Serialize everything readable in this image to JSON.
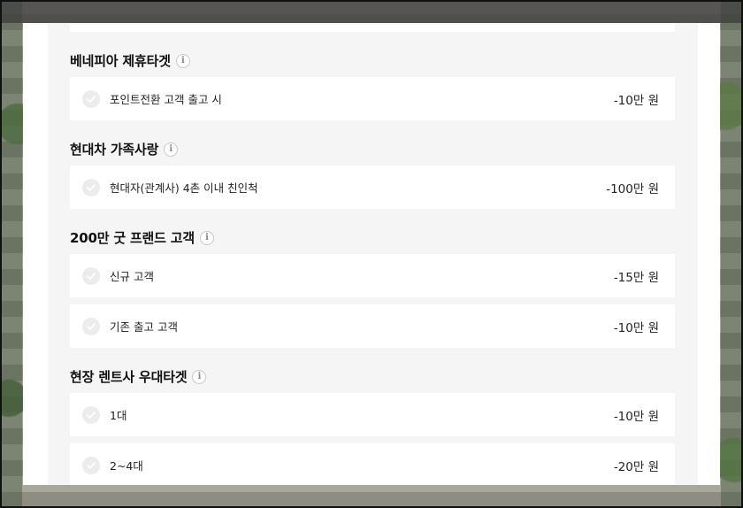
{
  "sections": [
    {
      "title": "베네피아 제휴타겟",
      "items": [
        {
          "label": "포인트전환 고객 출고 시",
          "amount": "-10만 원"
        }
      ]
    },
    {
      "title": "현대차 가족사랑",
      "items": [
        {
          "label": "현대자(관계사) 4촌 이내 친인척",
          "amount": "-100만 원"
        }
      ]
    },
    {
      "title": "200만 굿 프랜드 고객",
      "items": [
        {
          "label": "신규 고객",
          "amount": "-15만 원"
        },
        {
          "label": "기존 출고 고객",
          "amount": "-10만 원"
        }
      ]
    },
    {
      "title": "현장 렌트사 우대타겟",
      "items": [
        {
          "label": "1대",
          "amount": "-10만 원"
        },
        {
          "label": "2~4대",
          "amount": "-20만 원"
        }
      ]
    }
  ],
  "icons": {
    "info": "info-icon",
    "check": "check-circle-icon"
  },
  "info_glyph": "i"
}
